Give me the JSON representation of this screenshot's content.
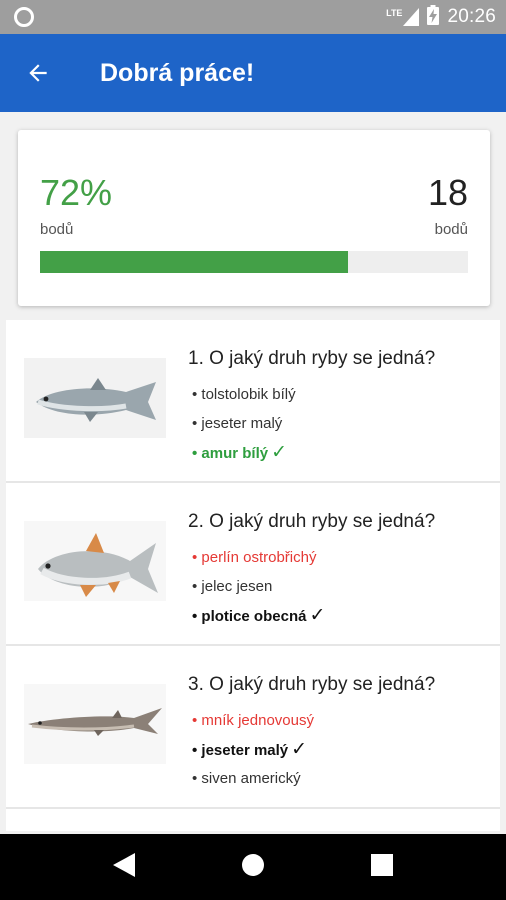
{
  "status_bar": {
    "time": "20:26",
    "network": "LTE",
    "notification_icon": "circle-icon",
    "signal_icon": "signal-icon",
    "battery_icon": "battery-charging-icon"
  },
  "app_bar": {
    "title": "Dobrá práce!",
    "back_icon": "arrow-left-icon",
    "background": "#1e64c8"
  },
  "score": {
    "percent": "72%",
    "percent_label": "bodů",
    "points": "18",
    "points_label": "bodů",
    "progress": 0.72,
    "accent": "#43a047"
  },
  "questions": [
    {
      "title": "1. O jaký druh ryby se jedná?",
      "image_icon": "fish-amur-icon",
      "options": [
        {
          "text": "tolstolobik bílý",
          "state": "normal"
        },
        {
          "text": "jeseter malý",
          "state": "normal"
        },
        {
          "text": "amur bílý",
          "state": "correct",
          "mark": "✓"
        }
      ]
    },
    {
      "title": "2. O jaký druh ryby se jedná?",
      "image_icon": "fish-plotice-icon",
      "options": [
        {
          "text": "perlín ostrobřichý",
          "state": "wrong"
        },
        {
          "text": "jelec jesen",
          "state": "normal"
        },
        {
          "text": "plotice obecná",
          "state": "answer",
          "mark": "✓"
        }
      ]
    },
    {
      "title": "3. O jaký druh ryby se jedná?",
      "image_icon": "fish-jeseter-icon",
      "options": [
        {
          "text": "mník jednovousý",
          "state": "wrong"
        },
        {
          "text": "jeseter malý",
          "state": "answer",
          "mark": "✓"
        },
        {
          "text": "siven americký",
          "state": "normal"
        }
      ]
    }
  ],
  "nav_bar": {
    "back_icon": "nav-back-icon",
    "home_icon": "nav-home-icon",
    "recents_icon": "nav-recents-icon"
  }
}
